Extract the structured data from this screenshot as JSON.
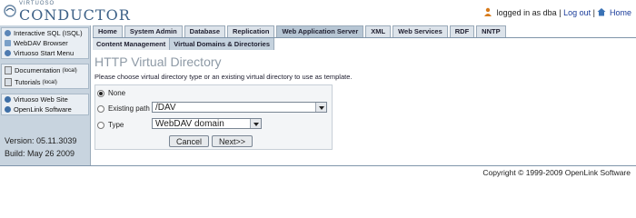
{
  "header": {
    "logo_small": "VIRTUOSO",
    "logo_big": "CONDUCTOR",
    "logged_in_text": "logged in as dba",
    "separator": "|",
    "logout": "Log out",
    "home": "Home"
  },
  "sidebar": {
    "groups": [
      [
        {
          "label": "Interactive SQL (ISQL)",
          "icon": "isql-icon"
        },
        {
          "label": "WebDAV Browser",
          "icon": "webdav-icon"
        },
        {
          "label": "Virtuoso Start Menu",
          "icon": "startmenu-icon"
        }
      ],
      [
        {
          "label": "Documentation",
          "suffix": "(local)",
          "icon": "documentation-icon"
        },
        {
          "label": "Tutorials",
          "suffix": "(local)",
          "icon": "tutorials-icon"
        }
      ],
      [
        {
          "label": "Virtuoso Web Site",
          "icon": "website-icon"
        },
        {
          "label": "OpenLink Software",
          "icon": "openlink-icon"
        }
      ]
    ],
    "version": "Version: 05.11.3039",
    "build": "Build: May 26 2009"
  },
  "tabs": [
    "Home",
    "System Admin",
    "Database",
    "Replication",
    "Web Application Server",
    "XML",
    "Web Services",
    "RDF",
    "NNTP"
  ],
  "subtabs": [
    "Content Management",
    "Virtual Domains & Directories"
  ],
  "main": {
    "title": "HTTP Virtual Directory",
    "instructions": "Please choose virtual directory type or an existing virtual directory to use as template.",
    "option_none": "None",
    "option_existing": "Existing path",
    "existing_value": "/DAV",
    "option_type": "Type",
    "type_value": "WebDAV domain",
    "cancel": "Cancel",
    "next": "Next>>"
  },
  "footer": {
    "copyright": "Copyright © 1999-2009 OpenLink Software"
  },
  "colors": {
    "sidebar_bg": "#c8d4df",
    "tab_active": "#b7c6d4",
    "title_color": "#8e9aa6",
    "link_color": "#1a3c9a"
  }
}
